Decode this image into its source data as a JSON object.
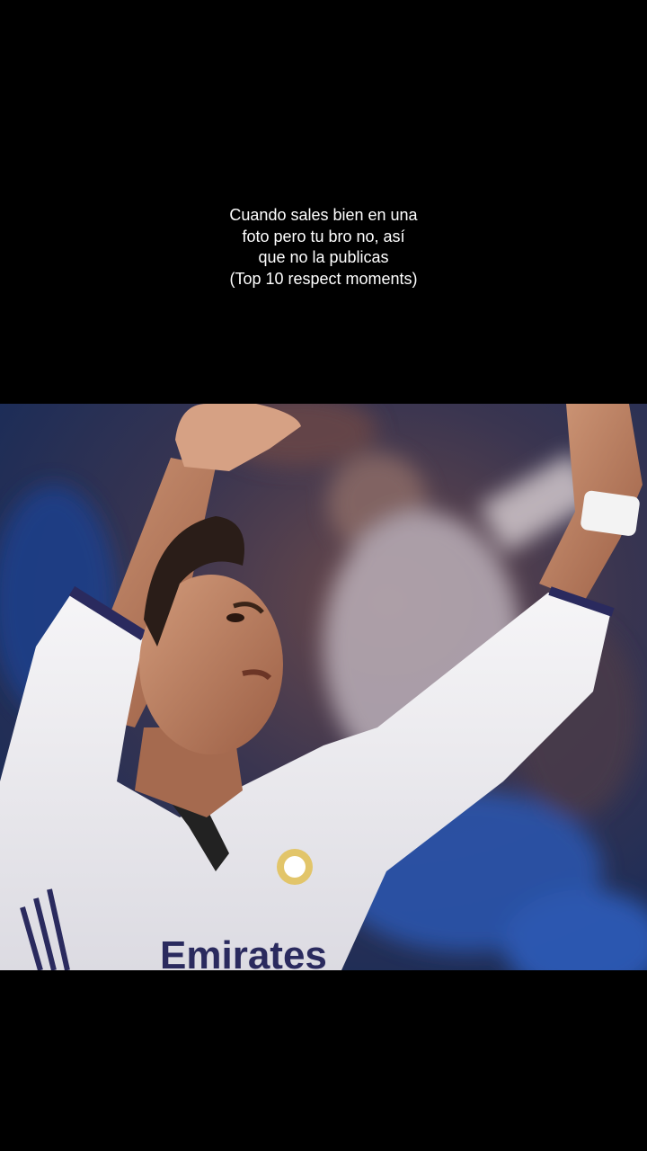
{
  "caption": {
    "lines": [
      "Cuando sales bien en una",
      "foto pero tu bro no, así",
      "que no la publicas",
      "(Top 10 respect moments)"
    ]
  },
  "video": {
    "description_icon": "video-still",
    "jersey_text": "Emirates"
  },
  "colors": {
    "background": "#000000",
    "caption_text": "#ffffff",
    "jersey_white": "#f2f1f3",
    "jersey_trim": "#2a2a5e",
    "crowd_blue": "#1f3d7a"
  }
}
